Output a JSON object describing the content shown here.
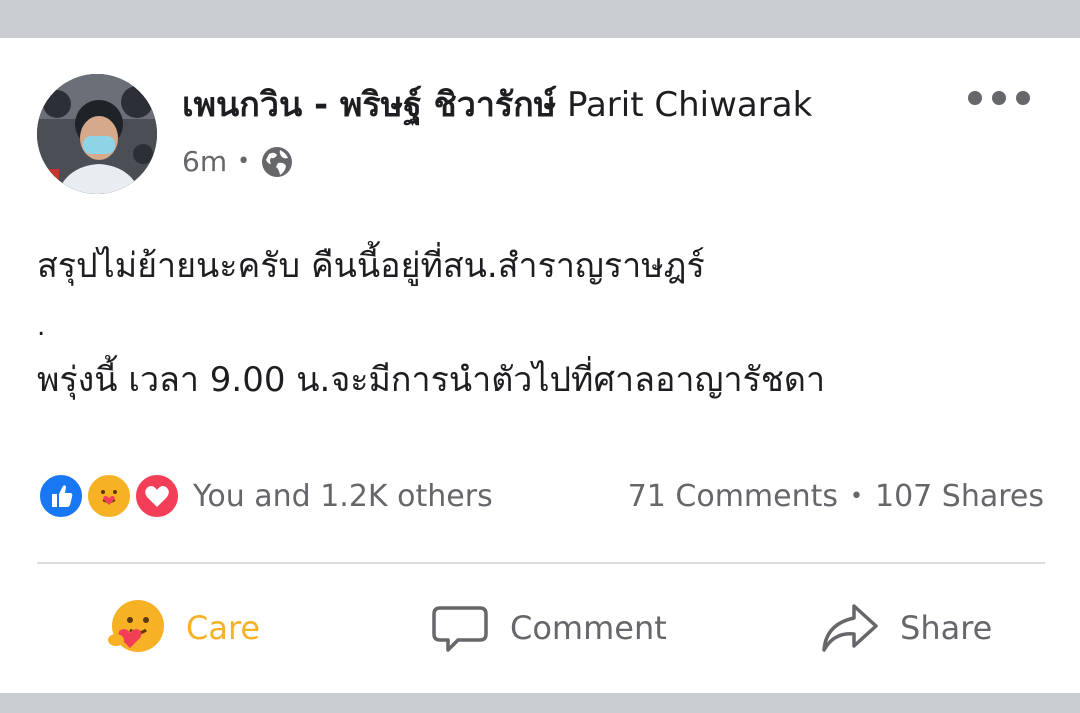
{
  "post": {
    "author_thai": "เพนกวิน - พริษฐ์ ชิวารักษ์",
    "author_latin": "Parit Chiwarak",
    "time": "6m",
    "separator": "•",
    "privacy_icon": "globe-icon",
    "line1": "สรุปไม่ย้ายนะครับ คืนนี้อยู่ที่สน.สำราญราษฎร์",
    "line2": ".",
    "line3": "พรุ่งนี้ เวลา 9.00 น.จะมีการนำตัวไปที่ศาลอาญารัชดา"
  },
  "reactions": {
    "icons": [
      "like-icon",
      "care-icon",
      "love-icon"
    ],
    "summary": "You and 1.2K others",
    "comments": "71 Comments",
    "separator": "•",
    "shares": "107 Shares"
  },
  "actions": {
    "care": "Care",
    "comment": "Comment",
    "share": "Share"
  },
  "colors": {
    "like": "#1877f2",
    "care": "#f7b125",
    "love": "#f33e58",
    "muted_text": "#65676b",
    "frame": "#c9ccd1"
  }
}
